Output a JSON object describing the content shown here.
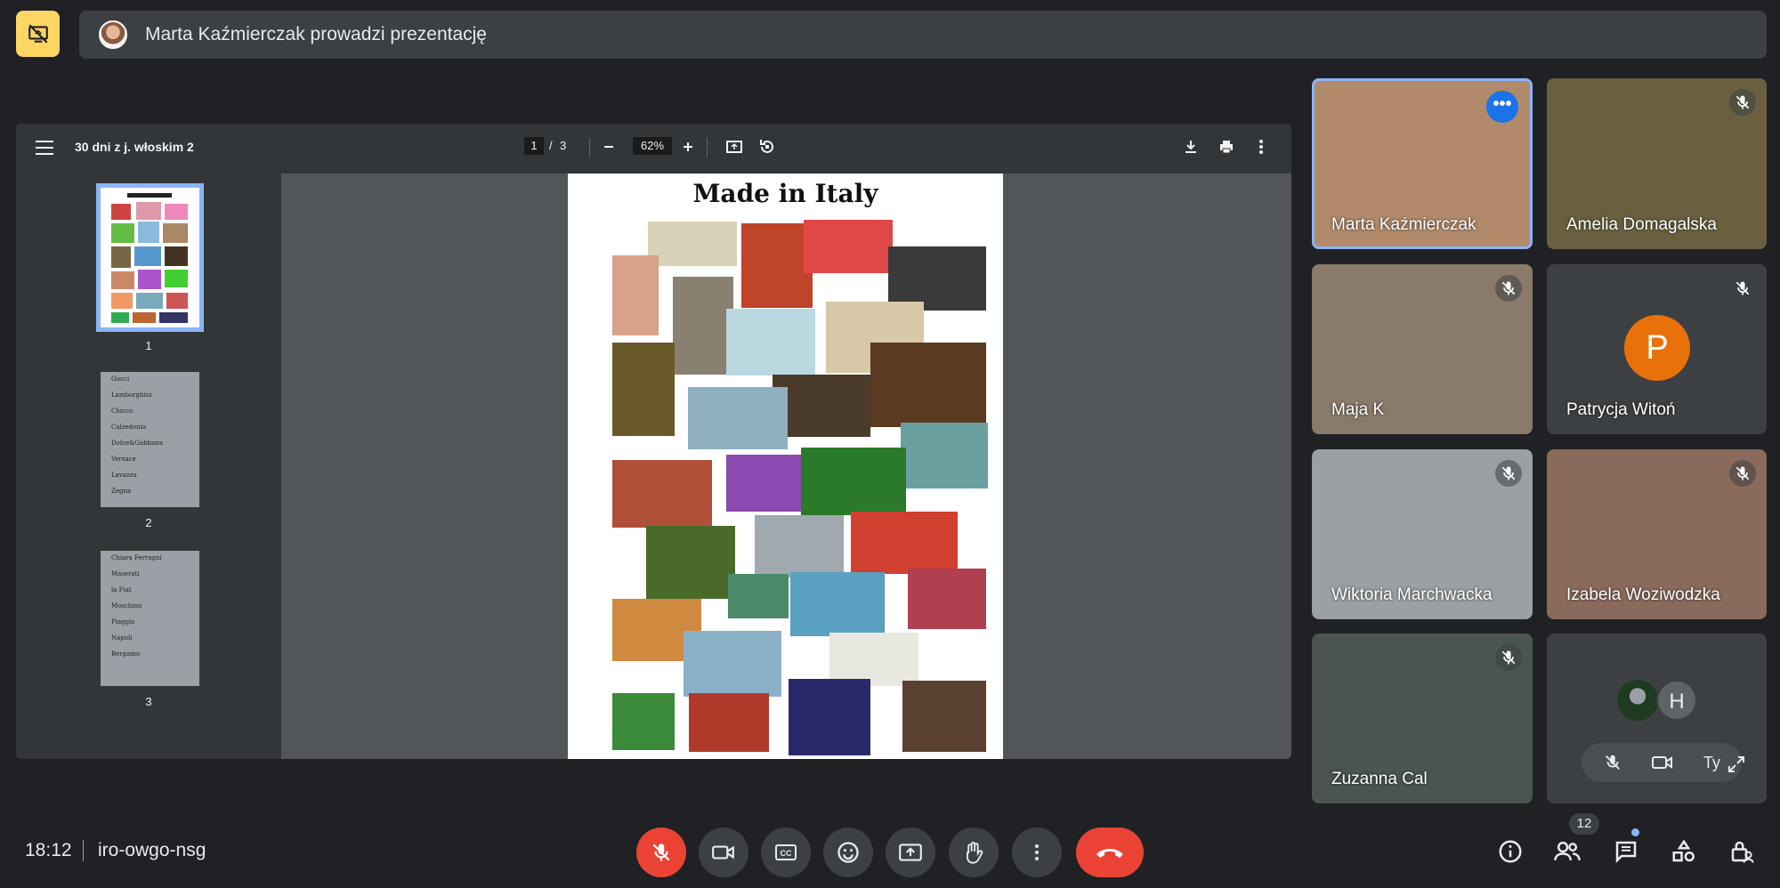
{
  "banner": {
    "presenter_text": "Marta Kaźmierczak prowadzi prezentację",
    "icon": "stop-presenting-icon"
  },
  "pdf": {
    "title": "30 dni z j. włoskim 2",
    "current_page": "1",
    "page_separator": "/",
    "total_pages": "3",
    "zoom": "62%",
    "page_heading": "Made in Italy",
    "thumbnails": [
      {
        "number": "1"
      },
      {
        "number": "2",
        "items": [
          "Gucci",
          "Lamborghini",
          "Chicco",
          "Calzedonia",
          "Dolce&Gabbana",
          "Versace",
          "Lavazza",
          "Zegna"
        ]
      },
      {
        "number": "3",
        "items": [
          "Chiara Ferragni",
          "Maserati",
          "la Fiat",
          "Moschino",
          "Piaggio",
          "Napoli",
          "Bergamo"
        ]
      }
    ]
  },
  "participants": [
    {
      "name": "Marta Kaźmierczak",
      "muted": false,
      "active": true
    },
    {
      "name": "Amelia Domagalska",
      "muted": true
    },
    {
      "name": "Maja K",
      "muted": true
    },
    {
      "name": "Patrycja Witoń",
      "muted": true,
      "initial": "P"
    },
    {
      "name": "Wiktoria Marchwacka",
      "muted": true
    },
    {
      "name": "Izabela Woziwodzka",
      "muted": true
    },
    {
      "name": "Zuzanna Cal",
      "muted": true
    }
  ],
  "self_tile": {
    "label": "Ty",
    "other_initial": "H"
  },
  "bottom": {
    "time": "18:12",
    "meeting_code": "iro-owgo-nsg",
    "participant_count": "12"
  },
  "colors": {
    "background": "#202124",
    "surface": "#3c4043",
    "accent_blue": "#8ab4f8",
    "danger_red": "#ea4335",
    "present_yellow": "#fdd663",
    "avatar_orange": "#e8710a"
  }
}
